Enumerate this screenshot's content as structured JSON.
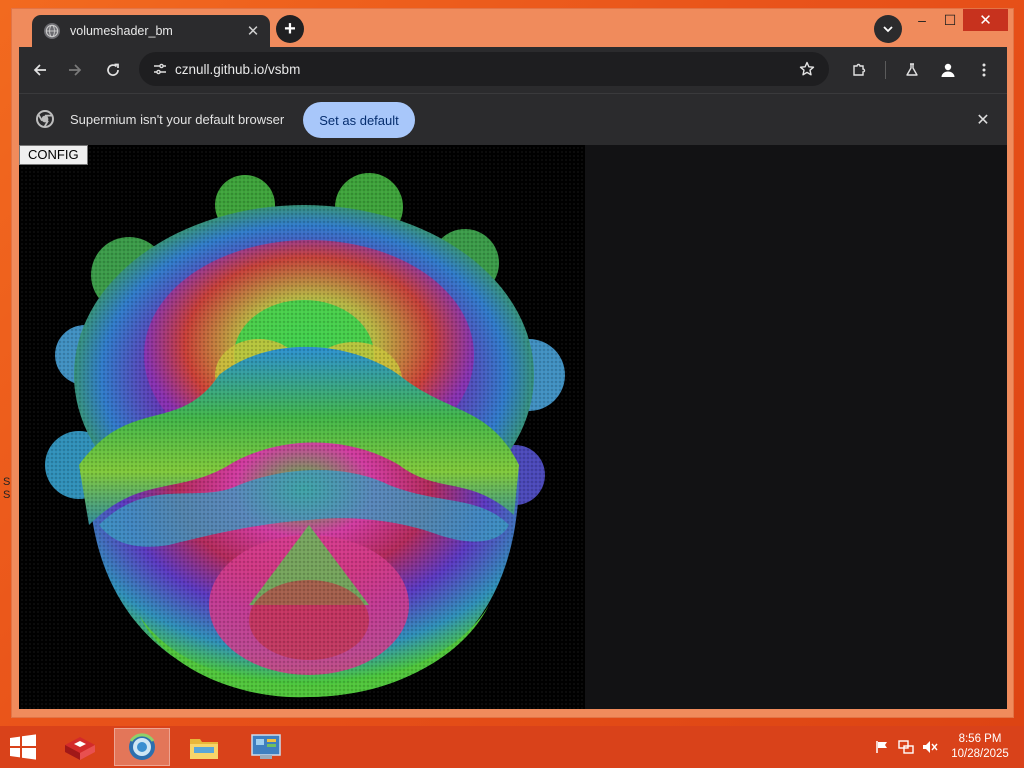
{
  "browser": {
    "tab_title": "volumeshader_bm",
    "tab_close": "✕",
    "new_tab": "+",
    "url": "cznull.github.io/vsbm",
    "window_min": "‒",
    "window_max": "☐",
    "window_close": "✕"
  },
  "infobar": {
    "message": "Supermium isn't your default browser",
    "button_label": "Set as default",
    "close": "✕"
  },
  "page": {
    "config_button": "CONFIG"
  },
  "desktop": {
    "left_edge_letters": [
      "S",
      "S"
    ]
  },
  "taskbar": {
    "apps": [
      "app-icon-red-box",
      "browser-icon",
      "file-explorer-icon",
      "control-panel-icon"
    ],
    "time": "8:56 PM",
    "date": "10/28/2025"
  },
  "colors": {
    "desktop": "#ea5514",
    "taskbar": "#d9421a",
    "browser_chrome": "#2b2b2d",
    "accent_button": "#a8c7fa",
    "close_red": "#c7321e"
  }
}
